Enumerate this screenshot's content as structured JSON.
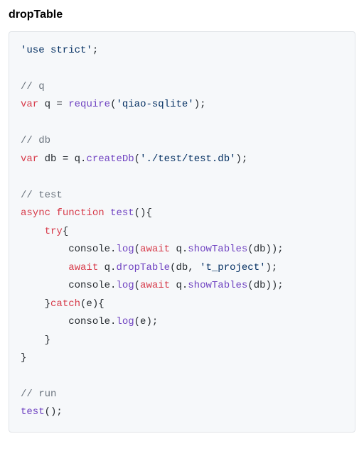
{
  "heading": "dropTable",
  "code": {
    "l1": {
      "s1": "'use strict'",
      "p1": ";"
    },
    "l3": {
      "c": "// q"
    },
    "l4": {
      "kw": "var",
      "id": "q",
      "eq": " = ",
      "fn": "require",
      "po": "(",
      "s": "'qiao-sqlite'",
      "pc": ");"
    },
    "l6": {
      "c": "// db"
    },
    "l7": {
      "kw": "var",
      "id": "db",
      "eq": " = q.",
      "fn": "createDb",
      "po": "(",
      "s": "'./test/test.db'",
      "pc": ");"
    },
    "l9": {
      "c": "// test"
    },
    "l10": {
      "kw1": "async",
      "kw2": "function",
      "name": "test",
      "tail": "(){"
    },
    "l11": {
      "ind": "    ",
      "kw": "try",
      "tail": "{"
    },
    "l12": {
      "ind1": "        console.",
      "fn1": "log",
      "po": "(",
      "kw": "await",
      "mid": " q.",
      "fn2": "showTables",
      "tail": "(db));"
    },
    "l13": {
      "ind1": "        ",
      "kw": "await",
      "mid": " q.",
      "fn": "dropTable",
      "args1": "(db, ",
      "s": "'t_project'",
      "tail": ");"
    },
    "l14": {
      "ind1": "        console.",
      "fn1": "log",
      "po": "(",
      "kw": "await",
      "mid": " q.",
      "fn2": "showTables",
      "tail": "(db));"
    },
    "l15": {
      "ind": "    }",
      "kw": "catch",
      "tail": "(e){"
    },
    "l16": {
      "ind1": "        console.",
      "fn": "log",
      "tail": "(e);"
    },
    "l17": {
      "t": "    }"
    },
    "l18": {
      "t": "}"
    },
    "l20": {
      "c": "// run"
    },
    "l21": {
      "fn": "test",
      "tail": "();"
    }
  }
}
